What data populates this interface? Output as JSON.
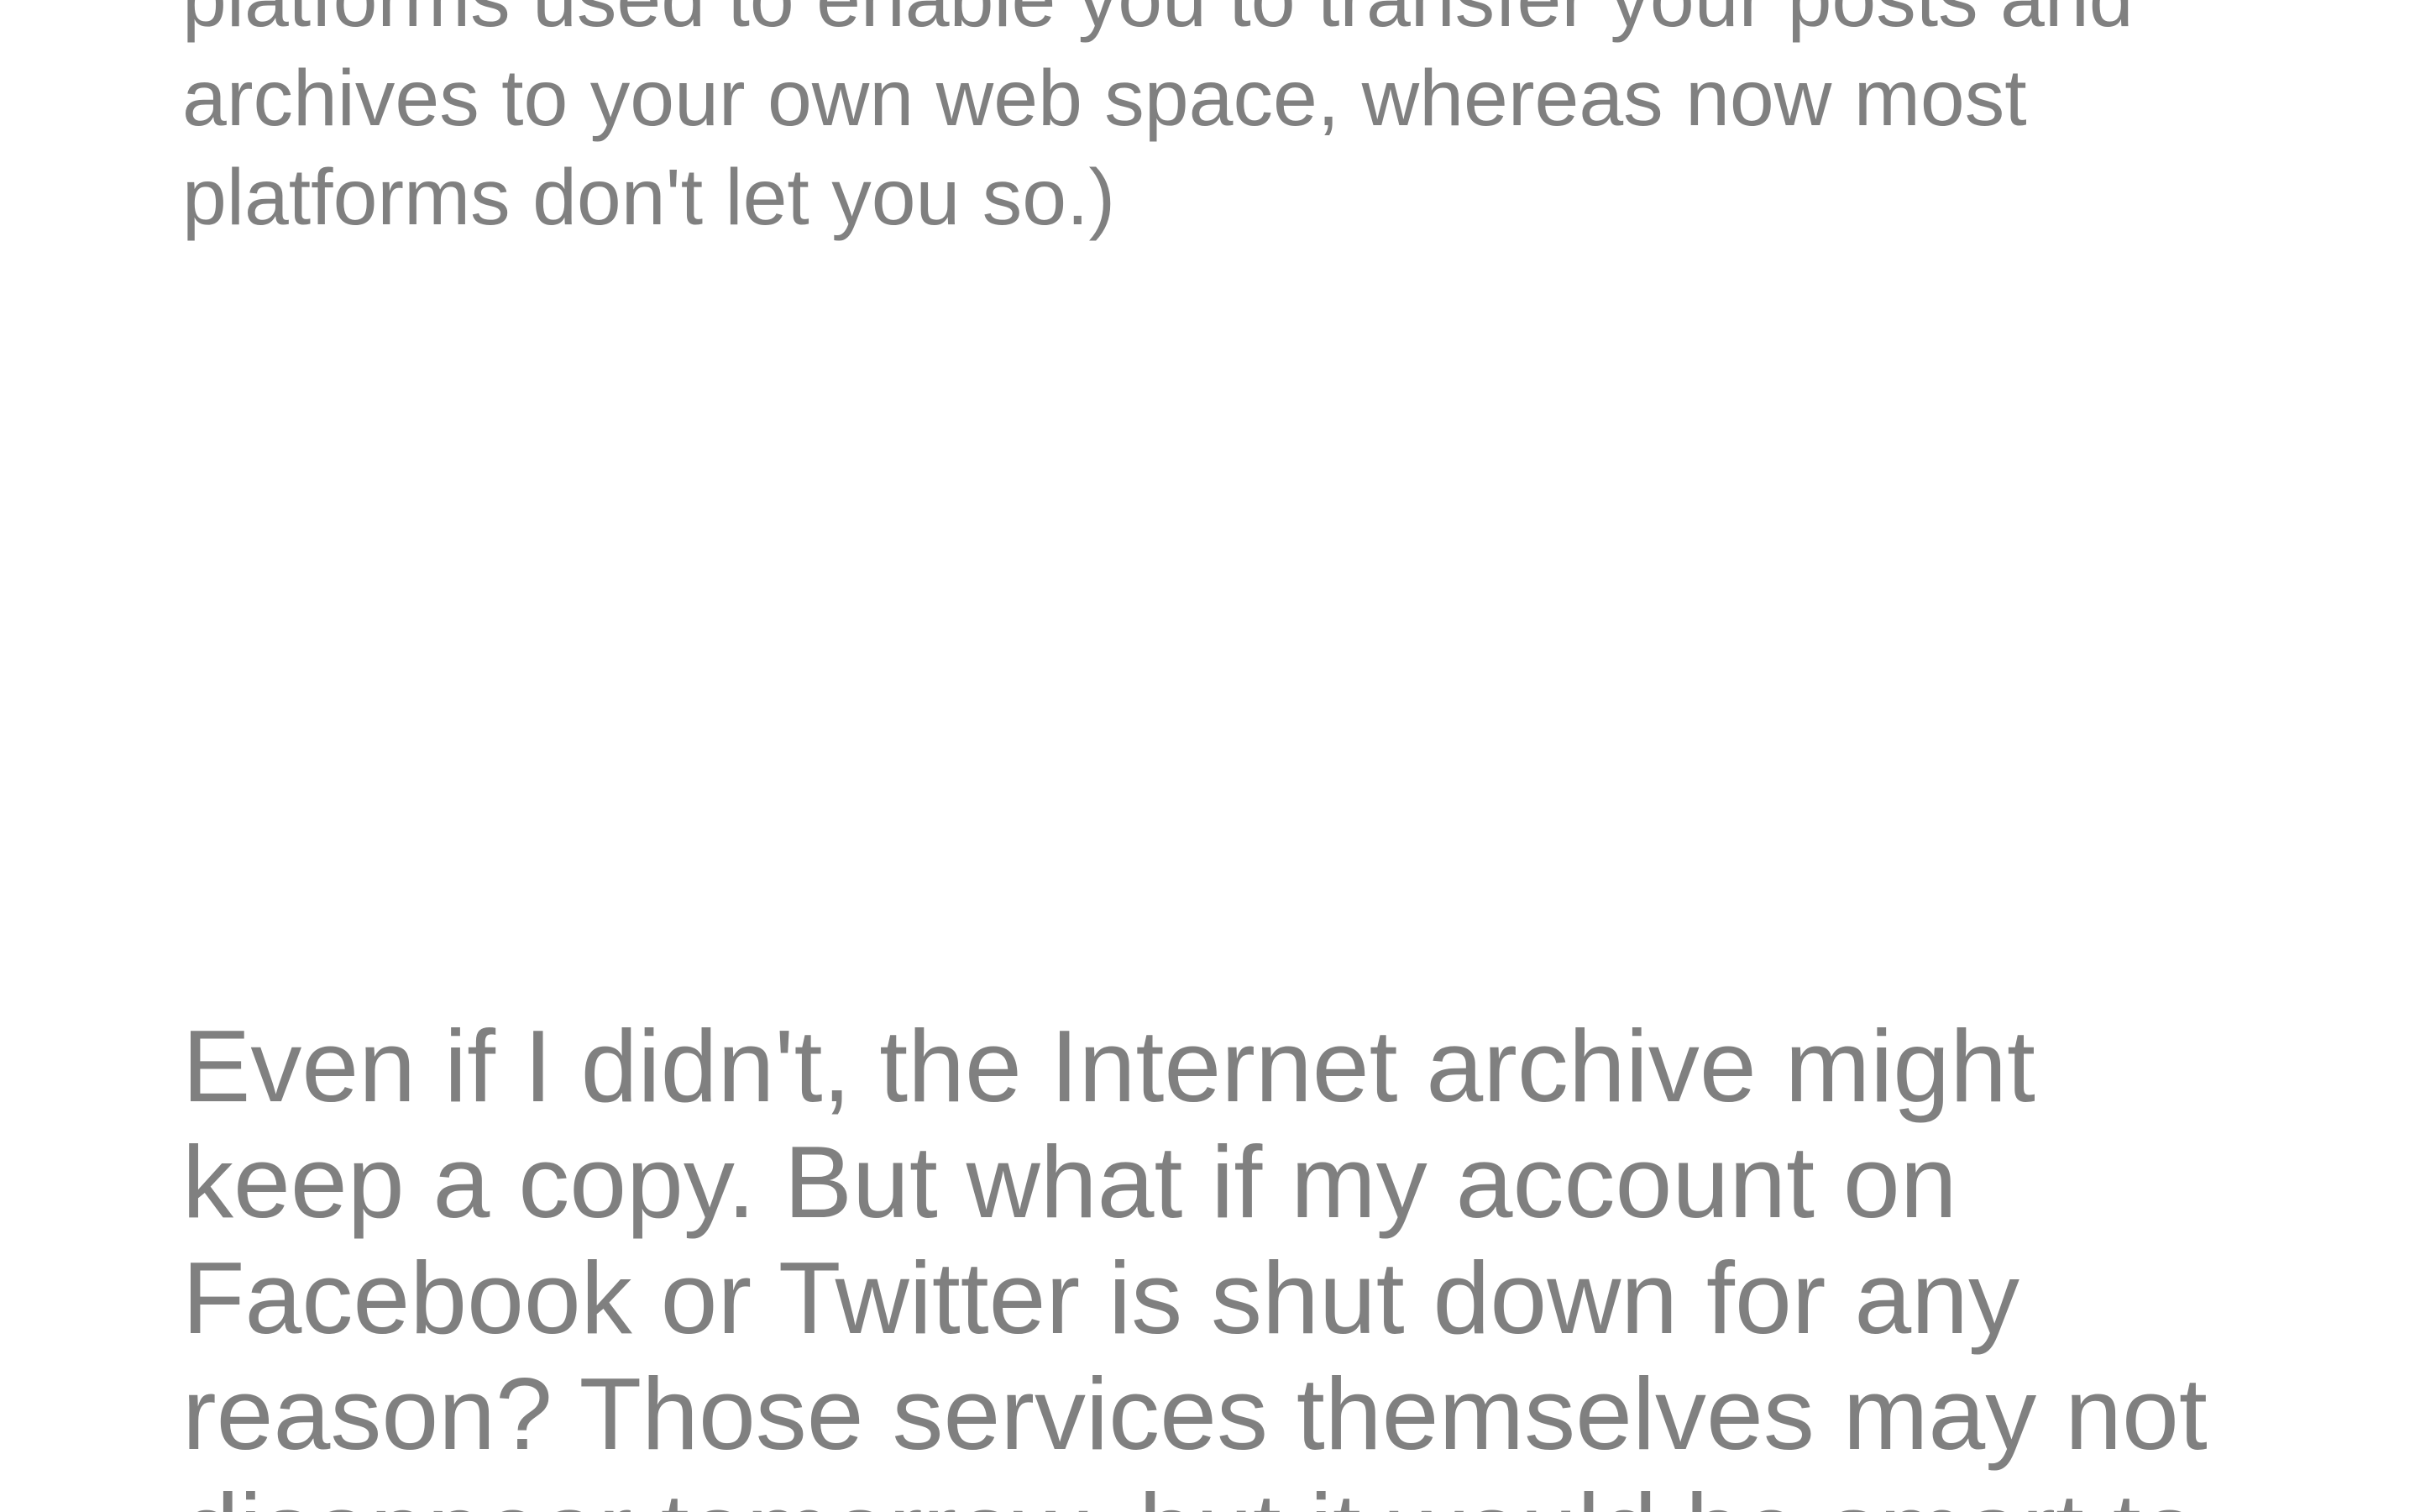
{
  "article": {
    "note_paragraph": "platforms used to enable you to transfer your posts and\narchives to your own web space, whereas now most\nplatforms don't let you so.)",
    "body_paragraph": "Even if I didn't, the Internet archive might\nkeep a copy. But what if my account on\nFacebook or Twitter is shut down for any\nreason? Those services themselves may not\ndisappear tomorrow, but it would be smart to"
  },
  "colors": {
    "background": "#ffffff",
    "text": "#808080"
  }
}
